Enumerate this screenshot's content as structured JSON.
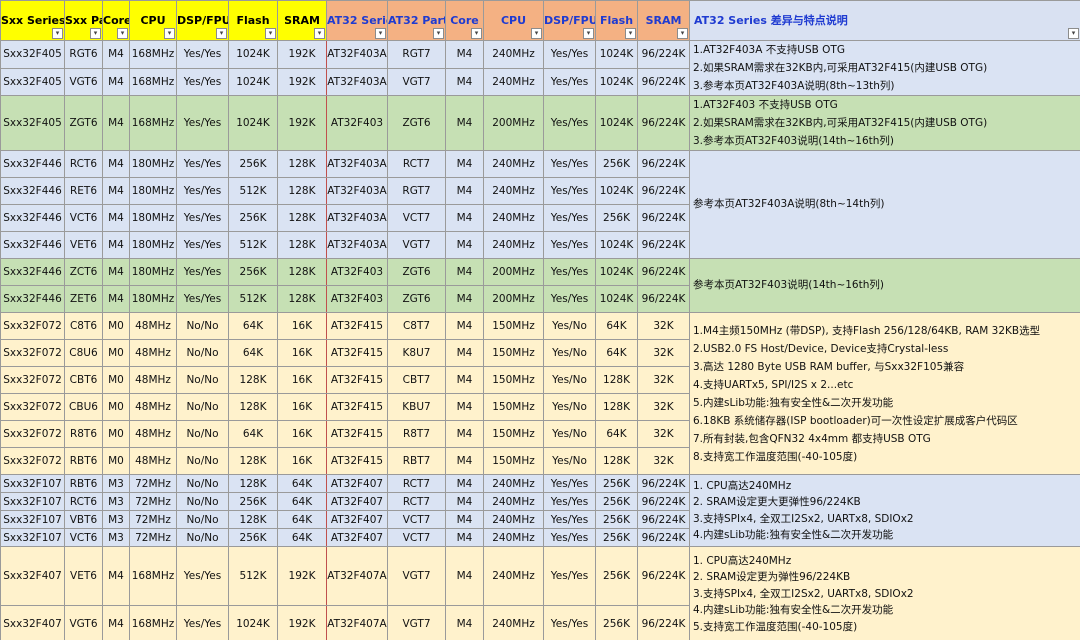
{
  "headers": {
    "sxx": [
      "Sxx Series",
      "Sxx Part",
      "Core",
      "CPU",
      "DSP/FPU",
      "Flash",
      "SRAM"
    ],
    "at32": [
      "AT32 Series",
      "AT32 Part",
      "Core",
      "CPU",
      "DSP/FPU",
      "Flash",
      "SRAM"
    ],
    "notes": "AT32 Series 差异与特点说明"
  },
  "rows": [
    {
      "c": [
        "Sxx32F405",
        "RGT6",
        "M4",
        "168MHz",
        "Yes/Yes",
        "1024K",
        "192K",
        "AT32F403A",
        "RGT7",
        "M4",
        "240MHz",
        "Yes/Yes",
        "1024K",
        "96/224K"
      ]
    },
    {
      "c": [
        "Sxx32F405",
        "VGT6",
        "M4",
        "168MHz",
        "Yes/Yes",
        "1024K",
        "192K",
        "AT32F403A",
        "VGT7",
        "M4",
        "240MHz",
        "Yes/Yes",
        "1024K",
        "96/224K"
      ]
    },
    {
      "c": [
        "Sxx32F405",
        "ZGT6",
        "M4",
        "168MHz",
        "Yes/Yes",
        "1024K",
        "192K",
        "AT32F403",
        "ZGT6",
        "M4",
        "200MHz",
        "Yes/Yes",
        "1024K",
        "96/224K"
      ]
    },
    {
      "c": [
        "Sxx32F446",
        "RCT6",
        "M4",
        "180MHz",
        "Yes/Yes",
        "256K",
        "128K",
        "AT32F403A",
        "RCT7",
        "M4",
        "240MHz",
        "Yes/Yes",
        "256K",
        "96/224K"
      ]
    },
    {
      "c": [
        "Sxx32F446",
        "RET6",
        "M4",
        "180MHz",
        "Yes/Yes",
        "512K",
        "128K",
        "AT32F403A",
        "RGT7",
        "M4",
        "240MHz",
        "Yes/Yes",
        "1024K",
        "96/224K"
      ]
    },
    {
      "c": [
        "Sxx32F446",
        "VCT6",
        "M4",
        "180MHz",
        "Yes/Yes",
        "256K",
        "128K",
        "AT32F403A",
        "VCT7",
        "M4",
        "240MHz",
        "Yes/Yes",
        "256K",
        "96/224K"
      ]
    },
    {
      "c": [
        "Sxx32F446",
        "VET6",
        "M4",
        "180MHz",
        "Yes/Yes",
        "512K",
        "128K",
        "AT32F403A",
        "VGT7",
        "M4",
        "240MHz",
        "Yes/Yes",
        "1024K",
        "96/224K"
      ]
    },
    {
      "c": [
        "Sxx32F446",
        "ZCT6",
        "M4",
        "180MHz",
        "Yes/Yes",
        "256K",
        "128K",
        "AT32F403",
        "ZGT6",
        "M4",
        "200MHz",
        "Yes/Yes",
        "1024K",
        "96/224K"
      ]
    },
    {
      "c": [
        "Sxx32F446",
        "ZET6",
        "M4",
        "180MHz",
        "Yes/Yes",
        "512K",
        "128K",
        "AT32F403",
        "ZGT6",
        "M4",
        "200MHz",
        "Yes/Yes",
        "1024K",
        "96/224K"
      ]
    },
    {
      "c": [
        "Sxx32F072",
        "C8T6",
        "M0",
        "48MHz",
        "No/No",
        "64K",
        "16K",
        "AT32F415",
        "C8T7",
        "M4",
        "150MHz",
        "Yes/No",
        "64K",
        "32K"
      ]
    },
    {
      "c": [
        "Sxx32F072",
        "C8U6",
        "M0",
        "48MHz",
        "No/No",
        "64K",
        "16K",
        "AT32F415",
        "K8U7",
        "M4",
        "150MHz",
        "Yes/No",
        "64K",
        "32K"
      ]
    },
    {
      "c": [
        "Sxx32F072",
        "CBT6",
        "M0",
        "48MHz",
        "No/No",
        "128K",
        "16K",
        "AT32F415",
        "CBT7",
        "M4",
        "150MHz",
        "Yes/No",
        "128K",
        "32K"
      ]
    },
    {
      "c": [
        "Sxx32F072",
        "CBU6",
        "M0",
        "48MHz",
        "No/No",
        "128K",
        "16K",
        "AT32F415",
        "KBU7",
        "M4",
        "150MHz",
        "Yes/No",
        "128K",
        "32K"
      ]
    },
    {
      "c": [
        "Sxx32F072",
        "R8T6",
        "M0",
        "48MHz",
        "No/No",
        "64K",
        "16K",
        "AT32F415",
        "R8T7",
        "M4",
        "150MHz",
        "Yes/No",
        "64K",
        "32K"
      ]
    },
    {
      "c": [
        "Sxx32F072",
        "RBT6",
        "M0",
        "48MHz",
        "No/No",
        "128K",
        "16K",
        "AT32F415",
        "RBT7",
        "M4",
        "150MHz",
        "Yes/No",
        "128K",
        "32K"
      ]
    },
    {
      "c": [
        "Sxx32F107",
        "RBT6",
        "M3",
        "72MHz",
        "No/No",
        "128K",
        "64K",
        "AT32F407",
        "RCT7",
        "M4",
        "240MHz",
        "Yes/Yes",
        "256K",
        "96/224K"
      ]
    },
    {
      "c": [
        "Sxx32F107",
        "RCT6",
        "M3",
        "72MHz",
        "No/No",
        "256K",
        "64K",
        "AT32F407",
        "RCT7",
        "M4",
        "240MHz",
        "Yes/Yes",
        "256K",
        "96/224K"
      ]
    },
    {
      "c": [
        "Sxx32F107",
        "VBT6",
        "M3",
        "72MHz",
        "No/No",
        "128K",
        "64K",
        "AT32F407",
        "VCT7",
        "M4",
        "240MHz",
        "Yes/Yes",
        "256K",
        "96/224K"
      ]
    },
    {
      "c": [
        "Sxx32F107",
        "VCT6",
        "M3",
        "72MHz",
        "No/No",
        "256K",
        "64K",
        "AT32F407",
        "VCT7",
        "M4",
        "240MHz",
        "Yes/Yes",
        "256K",
        "96/224K"
      ]
    },
    {
      "c": [
        "Sxx32F407",
        "VET6",
        "M4",
        "168MHz",
        "Yes/Yes",
        "512K",
        "192K",
        "AT32F407A",
        "VGT7",
        "M4",
        "240MHz",
        "Yes/Yes",
        "256K",
        "96/224K"
      ]
    },
    {
      "c": [
        "Sxx32F407",
        "VGT6",
        "M4",
        "168MHz",
        "Yes/Yes",
        "1024K",
        "192K",
        "AT32F407A",
        "VGT7",
        "M4",
        "240MHz",
        "Yes/Yes",
        "256K",
        "96/224K"
      ]
    }
  ],
  "notes": [
    [
      "1.AT32F403A 不支持USB OTG",
      "2.如果SRAM需求在32KB内,可采用AT32F415(内建USB OTG)",
      "3.参考本页AT32F403A说明(8th~13th列)"
    ],
    [
      "1.AT32F403 不支持USB OTG",
      "2.如果SRAM需求在32KB内,可采用AT32F415(内建USB OTG)",
      "3.参考本页AT32F403说明(14th~16th列)"
    ],
    [
      "参考本页AT32F403A说明(8th~14th列)"
    ],
    [
      "参考本页AT32F403说明(14th~16th列)"
    ],
    [
      "1.M4主频150MHz (带DSP), 支持Flash 256/128/64KB, RAM 32KB选型",
      "2.USB2.0 FS Host/Device, Device支持Crystal-less",
      "3.高达 1280 Byte USB RAM buffer, 与Sxx32F105兼容",
      "4.支持UARTx5, SPI/I2S x 2...etc",
      "5.内建sLib功能:独有安全性&二次开发功能",
      "6.18KB 系统储存器(ISP bootloader)可一次性设定扩展成客户代码区",
      "7.所有封装,包含QFN32 4x4mm 都支持USB OTG",
      "8.支持宽工作温度范围(-40-105度)"
    ],
    [
      "1. CPU高达240MHz",
      "2. SRAM设定更大更弹性96/224KB",
      "3.支持SPIx4, 全双工I2Sx2, UARTx8, SDIOx2",
      "4.内建sLib功能:独有安全性&二次开发功能"
    ],
    [
      "1. CPU高达240MHz",
      "2. SRAM设定更为弹性96/224KB",
      "3.支持SPIx4, 全双工I2Sx2, UARTx8, SDIOx2",
      "4.内建sLib功能:独有安全性&二次开发功能",
      "5.支持宽工作温度范围(-40-105度)"
    ]
  ]
}
